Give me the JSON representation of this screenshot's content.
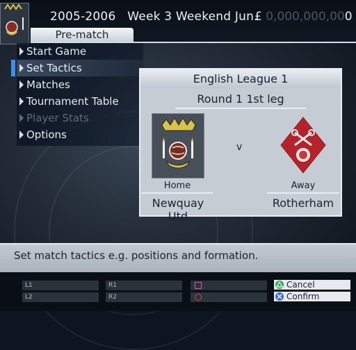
{
  "header": {
    "season": "2005-2006",
    "week": "Week 3 Weekend Jun.",
    "currency": "£",
    "money_hidden": "0,000,000,00",
    "money_last": "0",
    "screen_tab": "Pre-match"
  },
  "menu": {
    "items": [
      {
        "label": "Start Game",
        "enabled": true
      },
      {
        "label": "Set Tactics",
        "enabled": true,
        "selected": true
      },
      {
        "label": "Matches",
        "enabled": true
      },
      {
        "label": "Tournament Table",
        "enabled": true
      },
      {
        "label": "Player Stats",
        "enabled": false
      },
      {
        "label": "Options",
        "enabled": true
      }
    ]
  },
  "match": {
    "competition": "English League 1",
    "round": "Round 1 1st leg",
    "versus": "v",
    "home": {
      "label": "Home",
      "team": "Newquay Utd"
    },
    "away": {
      "label": "Away",
      "team": "Rotherham"
    }
  },
  "help": {
    "text": "Set match tactics e.g. positions and formation."
  },
  "buttons": {
    "l1": "L1",
    "l2": "L2",
    "r1": "R1",
    "r2": "R2",
    "cancel": "Cancel",
    "confirm": "Confirm"
  },
  "colors": {
    "accent": "#3f8ee8",
    "away_crest": "#b4232a",
    "home_crest_bg": "#474f59",
    "triangle": "#2fa84f",
    "cross": "#3a6fd8",
    "square": "#d85aa8",
    "circle": "#d84a3a"
  }
}
